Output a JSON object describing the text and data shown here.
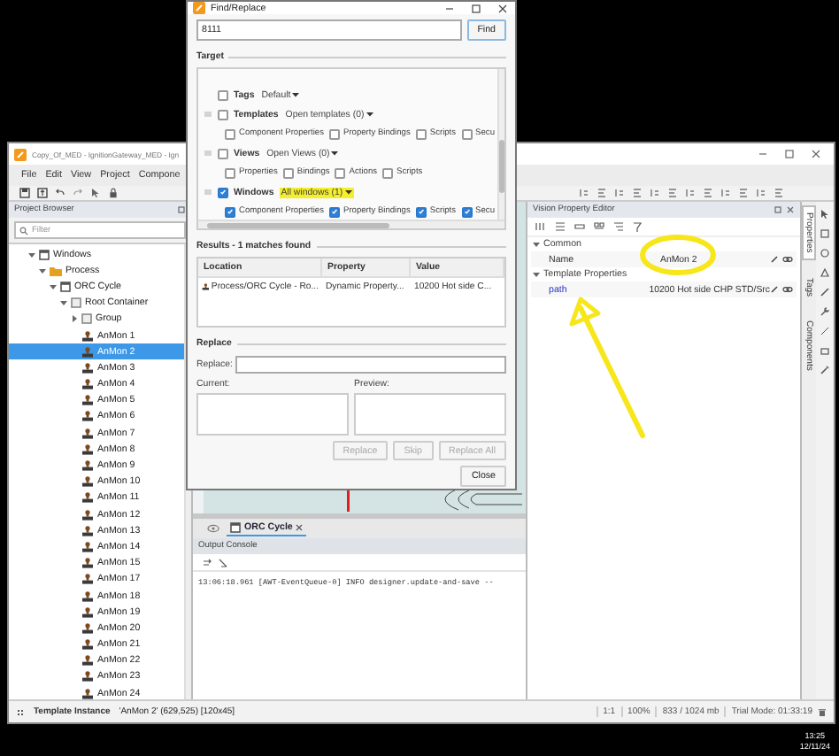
{
  "desktop": {
    "clock_time": "13:25",
    "clock_date": "12/11/24"
  },
  "designer": {
    "title": "Copy_Of_MED - IgnitionGateway_MED - Ign",
    "menu": [
      "File",
      "Edit",
      "View",
      "Project",
      "Compone"
    ],
    "project_browser": {
      "title": "Project Browser",
      "filter_placeholder": "Filter",
      "tree": [
        {
          "label": "Windows",
          "kind": "windows",
          "selected": false,
          "expanded": true,
          "children": [
            {
              "label": "Process",
              "kind": "folder",
              "selected": false,
              "expanded": true,
              "children": [
                {
                  "label": "ORC Cycle",
                  "kind": "window",
                  "selected": false,
                  "expanded": true,
                  "children": [
                    {
                      "label": "Root Container",
                      "kind": "container",
                      "selected": false,
                      "expanded": true,
                      "children": [
                        {
                          "label": "Group",
                          "kind": "container",
                          "selected": false,
                          "expanded": false
                        },
                        {
                          "label": "AnMon 1",
                          "kind": "template",
                          "selected": false
                        },
                        {
                          "label": "AnMon 2",
                          "kind": "template",
                          "selected": true
                        },
                        {
                          "label": "AnMon 3",
                          "kind": "template",
                          "selected": false
                        },
                        {
                          "label": "AnMon 4",
                          "kind": "template",
                          "selected": false
                        },
                        {
                          "label": "AnMon 5",
                          "kind": "template",
                          "selected": false
                        },
                        {
                          "label": "AnMon 6",
                          "kind": "template",
                          "selected": false
                        },
                        {
                          "label": "AnMon 7",
                          "kind": "template",
                          "selected": false
                        },
                        {
                          "label": "AnMon 8",
                          "kind": "template",
                          "selected": false
                        },
                        {
                          "label": "AnMon 9",
                          "kind": "template",
                          "selected": false
                        },
                        {
                          "label": "AnMon 10",
                          "kind": "template",
                          "selected": false
                        },
                        {
                          "label": "AnMon 11",
                          "kind": "template",
                          "selected": false
                        },
                        {
                          "label": "AnMon 12",
                          "kind": "template",
                          "selected": false
                        },
                        {
                          "label": "AnMon 13",
                          "kind": "template",
                          "selected": false
                        },
                        {
                          "label": "AnMon 14",
                          "kind": "template",
                          "selected": false
                        },
                        {
                          "label": "AnMon 15",
                          "kind": "template",
                          "selected": false
                        },
                        {
                          "label": "AnMon 17",
                          "kind": "template",
                          "selected": false
                        },
                        {
                          "label": "AnMon 18",
                          "kind": "template",
                          "selected": false
                        },
                        {
                          "label": "AnMon 19",
                          "kind": "template",
                          "selected": false
                        },
                        {
                          "label": "AnMon 20",
                          "kind": "template",
                          "selected": false
                        },
                        {
                          "label": "AnMon 21",
                          "kind": "template",
                          "selected": false
                        },
                        {
                          "label": "AnMon 22",
                          "kind": "template",
                          "selected": false
                        },
                        {
                          "label": "AnMon 23",
                          "kind": "template",
                          "selected": false
                        },
                        {
                          "label": "AnMon 24",
                          "kind": "template",
                          "selected": false
                        }
                      ]
                    }
                  ]
                }
              ]
            }
          ]
        }
      ]
    },
    "workspace": {
      "tabs": [
        {
          "label": "ORC Cycle",
          "selected": true
        }
      ],
      "console_title": "Output Console",
      "console_lines": [
        "13:06:18.961 [AWT-EventQueue-0] INFO designer.update-and-save --"
      ]
    },
    "property_editor": {
      "title": "Vision Property Editor",
      "groups": [
        {
          "label": "Common",
          "expanded": true,
          "rows": [
            {
              "name": "Name",
              "value": "AnMon 2",
              "kind": "standard"
            }
          ]
        },
        {
          "label": "Template Properties",
          "expanded": true,
          "rows": [
            {
              "name": "path",
              "value": "10200 Hot side CHP STD/Src",
              "kind": "custom"
            }
          ]
        }
      ]
    },
    "side_tabs": [
      {
        "label": "Properties",
        "selected": true
      },
      {
        "label": "Tags",
        "selected": false
      },
      {
        "label": "Components",
        "selected": false
      }
    ],
    "status_bar": {
      "selection_type": "Template Instance",
      "selection_detail": "'AnMon 2' (629,525) [120x45]",
      "ratio": "1:1",
      "zoom": "100%",
      "memory": "833 / 1024 mb",
      "trial": "Trial Mode: 01:33:19"
    }
  },
  "find_replace": {
    "title": "Find/Replace",
    "search_value": "8111",
    "find_button": "Find",
    "target_label": "Target",
    "targets": [
      {
        "label": "Tags",
        "checked": false,
        "scope": "Default",
        "highlighted": false
      },
      {
        "label": "Templates",
        "checked": false,
        "scope": "Open templates (0)",
        "highlighted": false,
        "options": [
          {
            "label": "Component Properties",
            "checked": false
          },
          {
            "label": "Property Bindings",
            "checked": false
          },
          {
            "label": "Scripts",
            "checked": false
          },
          {
            "label": "Secu",
            "checked": false
          }
        ]
      },
      {
        "label": "Views",
        "checked": false,
        "scope": "Open Views (0)",
        "highlighted": false,
        "options": [
          {
            "label": "Properties",
            "checked": false
          },
          {
            "label": "Bindings",
            "checked": false
          },
          {
            "label": "Actions",
            "checked": false
          },
          {
            "label": "Scripts",
            "checked": false
          }
        ]
      },
      {
        "label": "Windows",
        "checked": true,
        "scope": "All windows (1)",
        "highlighted": true,
        "options": [
          {
            "label": "Component Properties",
            "checked": true
          },
          {
            "label": "Property Bindings",
            "checked": true
          },
          {
            "label": "Scripts",
            "checked": true
          },
          {
            "label": "Secu",
            "checked": true
          }
        ]
      }
    ],
    "results_label": "Results - 1 matches found",
    "columns": [
      "Location",
      "Property",
      "Value"
    ],
    "rows": [
      [
        "Process/ORC Cycle - Ro...",
        "Dynamic Property...",
        "10200 Hot side C..."
      ]
    ],
    "replace_label": "Replace",
    "replace_field_label": "Replace:",
    "current_label": "Current:",
    "preview_label": "Preview:",
    "buttons": [
      {
        "label": "Replace",
        "disabled": true
      },
      {
        "label": "Skip",
        "disabled": true
      },
      {
        "label": "Replace All",
        "disabled": true
      }
    ],
    "close_button": "Close"
  }
}
